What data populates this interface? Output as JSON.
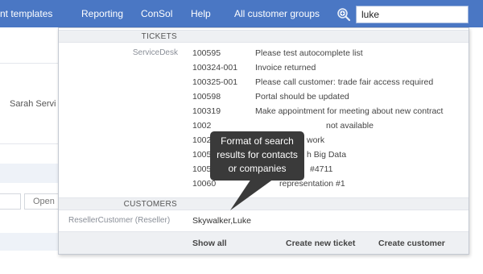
{
  "nav": {
    "items": [
      "nt templates",
      "Reporting",
      "ConSol",
      "Help",
      "All customer groups"
    ],
    "search_value": "luke"
  },
  "background": {
    "agent_name": "Sarah Servi",
    "open_button": "Open"
  },
  "dropdown": {
    "tickets_header": "TICKETS",
    "tickets_group": "ServiceDesk",
    "tickets": [
      {
        "id": "100595",
        "title": "Please test autocomplete list"
      },
      {
        "id": "100324-001",
        "title": "Invoice returned"
      },
      {
        "id": "100325-001",
        "title": "Please call customer: trade fair access required"
      },
      {
        "id": "100598",
        "title": "Portal should be updated"
      },
      {
        "id": "100319",
        "title": "Make appointment for meeting about new contract"
      },
      {
        "id": "1002",
        "title": "not available"
      },
      {
        "id": "1002",
        "title": "work"
      },
      {
        "id": "1005",
        "title": "h Big Data"
      },
      {
        "id": "1005",
        "title": "#4711"
      },
      {
        "id": "10060",
        "title": "representation #1"
      }
    ],
    "customers_header": "CUSTOMERS",
    "customer_group": "ResellerCustomer (Reseller)",
    "customer": "Skywalker,Luke",
    "footer": {
      "show_all": "Show all",
      "create_ticket": "Create new ticket",
      "create_customer": "Create customer"
    }
  },
  "tooltip": {
    "line1": "Format of search",
    "line2": "results for contacts",
    "line3": "or companies"
  },
  "colors": {
    "nav_bar": "#4a77c4",
    "tooltip_bg": "#3a3a3a",
    "section_header_bg": "#eef0f3"
  }
}
